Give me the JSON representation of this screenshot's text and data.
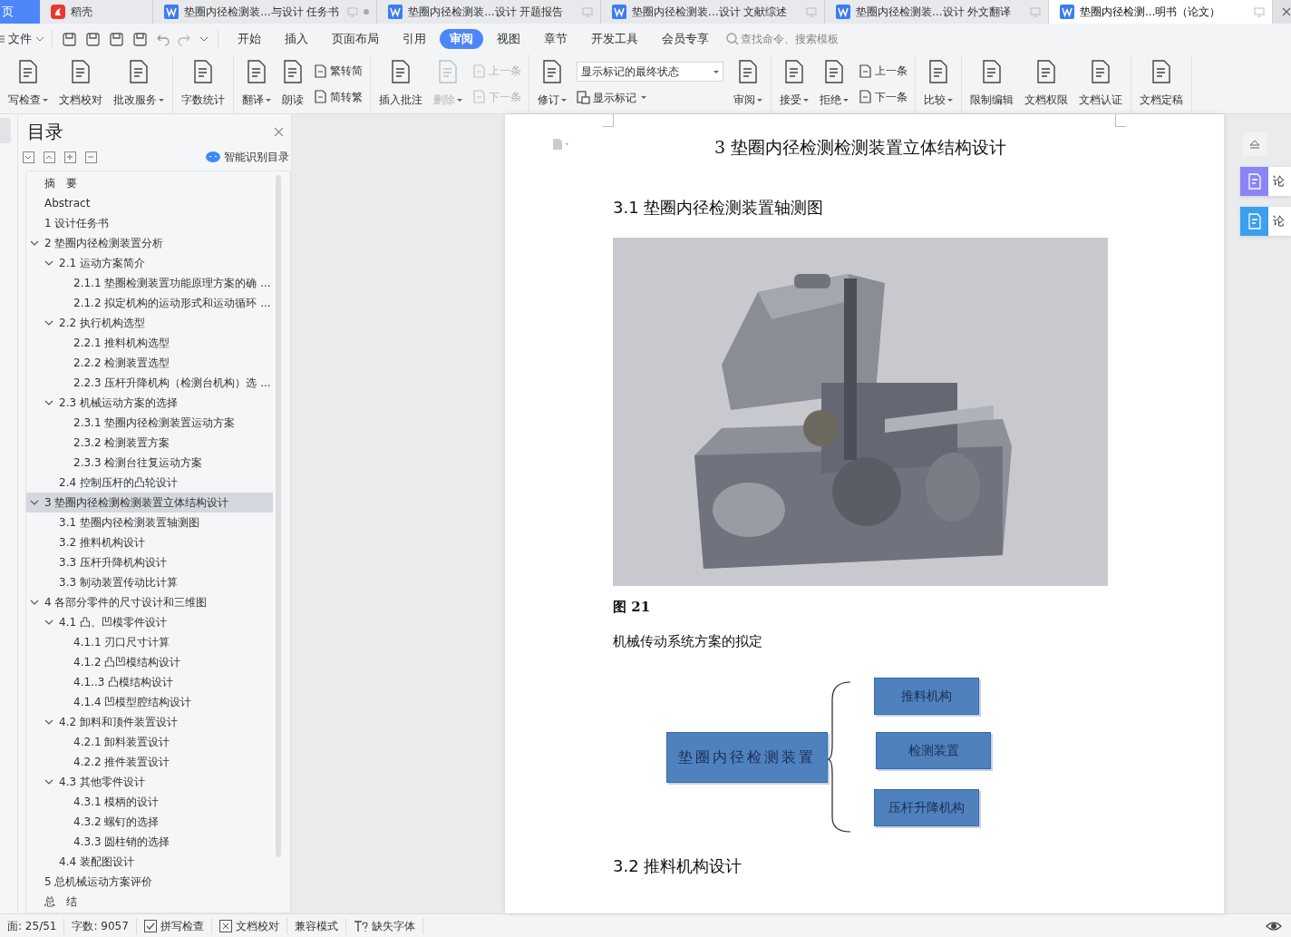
{
  "tab_bar": {
    "tabs": [
      {
        "label": "页",
        "kind": "home",
        "selected": false
      },
      {
        "label": "稻壳",
        "kind": "docer",
        "selected": false
      },
      {
        "label": "垫圈内径检测装...与设计 任务书",
        "kind": "doc",
        "selected": false,
        "unsaved": true
      },
      {
        "label": "垫圈内径检测装...设计 开题报告",
        "kind": "doc",
        "selected": false,
        "unsaved": false
      },
      {
        "label": "垫圈内径检测装...设计 文献综述",
        "kind": "doc",
        "selected": false,
        "unsaved": false
      },
      {
        "label": "垫圈内径检测装...设计 外文翻译",
        "kind": "doc",
        "selected": false,
        "unsaved": false
      },
      {
        "label": "垫圈内径检测...明书（论文）",
        "kind": "doc",
        "selected": true,
        "unsaved": false
      }
    ]
  },
  "menu_bar": {
    "file": "文件",
    "tabs": [
      {
        "label": "开始",
        "selected": false
      },
      {
        "label": "插入",
        "selected": false
      },
      {
        "label": "页面布局",
        "selected": false
      },
      {
        "label": "引用",
        "selected": false
      },
      {
        "label": "审阅",
        "selected": true
      },
      {
        "label": "视图",
        "selected": false
      },
      {
        "label": "章节",
        "selected": false
      },
      {
        "label": "开发工具",
        "selected": false
      },
      {
        "label": "会员专享",
        "selected": false
      }
    ],
    "search": {
      "placeholder": "查找命令、搜索模板"
    }
  },
  "ribbon": {
    "groups": [
      [
        {
          "kind": "big",
          "label": "写检查",
          "dropdown": true,
          "disabled": false
        },
        {
          "kind": "big",
          "label": "文档校对",
          "dropdown": false,
          "disabled": false
        },
        {
          "kind": "big",
          "label": "批改服务",
          "dropdown": true,
          "disabled": false
        }
      ],
      [
        {
          "kind": "big",
          "label": "字数统计",
          "dropdown": false,
          "disabled": false
        }
      ],
      [
        {
          "kind": "big",
          "label": "翻译",
          "dropdown": true,
          "disabled": false
        },
        {
          "kind": "big",
          "label": "朗读",
          "dropdown": false,
          "disabled": false
        },
        {
          "kind": "pair",
          "rows": [
            {
              "label": "繁转简",
              "disabled": false
            },
            {
              "label": "简转繁",
              "disabled": false
            }
          ]
        }
      ],
      [
        {
          "kind": "big",
          "label": "插入批注",
          "dropdown": false,
          "disabled": false
        },
        {
          "kind": "big",
          "label": "删除",
          "dropdown": true,
          "disabled": true
        },
        {
          "kind": "pair",
          "rows": [
            {
              "label": "上一条",
              "disabled": true
            },
            {
              "label": "下一条",
              "disabled": true
            }
          ]
        }
      ],
      [
        {
          "kind": "big",
          "label": "修订",
          "dropdown": true,
          "disabled": false
        },
        {
          "kind": "combo",
          "value": "显示标记的最终状态",
          "button": "显示标记"
        },
        {
          "kind": "big",
          "label": "审阅",
          "dropdown": true,
          "disabled": false
        }
      ],
      [
        {
          "kind": "big",
          "label": "接受",
          "dropdown": true,
          "disabled": false
        },
        {
          "kind": "big",
          "label": "拒绝",
          "dropdown": true,
          "disabled": false
        },
        {
          "kind": "pair",
          "rows": [
            {
              "label": "上一条",
              "disabled": false
            },
            {
              "label": "下一条",
              "disabled": false
            }
          ]
        }
      ],
      [
        {
          "kind": "big",
          "label": "比较",
          "dropdown": true,
          "disabled": false
        }
      ],
      [
        {
          "kind": "big",
          "label": "限制编辑",
          "dropdown": false,
          "disabled": false
        },
        {
          "kind": "big",
          "label": "文档权限",
          "dropdown": false,
          "disabled": false
        },
        {
          "kind": "big",
          "label": "文档认证",
          "dropdown": false,
          "disabled": false
        }
      ],
      [
        {
          "kind": "big",
          "label": "文档定稿",
          "dropdown": false,
          "disabled": false
        }
      ]
    ]
  },
  "toc": {
    "title": "目录",
    "smart_button": "智能识别目录",
    "items": [
      {
        "label": "摘　要",
        "selected": false
      },
      {
        "label": "Abstract",
        "selected": false
      },
      {
        "label": "1 设计任务书",
        "selected": false
      },
      {
        "label": "2 垫圈内径检测装置分析",
        "selected": false,
        "expanded": true,
        "children": [
          {
            "label": "2.1 运动方案简介",
            "selected": false,
            "expanded": true,
            "children": [
              {
                "label": "2.1.1 垫圈检测装置功能原理方案的确 ...",
                "selected": false
              },
              {
                "label": "2.1.2 拟定机构的运动形式和运动循环 ...",
                "selected": false
              }
            ]
          },
          {
            "label": "2.2 执行机构选型",
            "selected": false,
            "expanded": true,
            "children": [
              {
                "label": "2.2.1 推料机构选型",
                "selected": false
              },
              {
                "label": "2.2.2 检测装置选型",
                "selected": false
              },
              {
                "label": "2.2.3 压杆升降机构（检测台机构）选 ...",
                "selected": false
              }
            ]
          },
          {
            "label": "2.3 机械运动方案的选择",
            "selected": false,
            "expanded": true,
            "children": [
              {
                "label": "2.3.1 垫圈内径检测装置运动方案",
                "selected": false
              },
              {
                "label": "2.3.2 检测装置方案",
                "selected": false
              },
              {
                "label": "2.3.3 检测台往复运动方案",
                "selected": false
              }
            ]
          },
          {
            "label": "2.4 控制压杆的凸轮设计",
            "selected": false
          }
        ]
      },
      {
        "label": "3 垫圈内径检测检测装置立体结构设计",
        "selected": true,
        "expanded": true,
        "children": [
          {
            "label": "3.1 垫圈内径检测装置轴测图",
            "selected": false
          },
          {
            "label": "3.2 推料机构设计",
            "selected": false
          },
          {
            "label": "3.3 压杆升降机构设计",
            "selected": false
          },
          {
            "label": "3.3 制动装置传动比计算",
            "selected": false
          }
        ]
      },
      {
        "label": "4 各部分零件的尺寸设计和三维图",
        "selected": false,
        "expanded": true,
        "children": [
          {
            "label": "4.1 凸、凹模零件设计",
            "selected": false,
            "expanded": true,
            "children": [
              {
                "label": "4.1.1 刃口尺寸计算",
                "selected": false
              },
              {
                "label": "4.1.2 凸凹模结构设计",
                "selected": false
              },
              {
                "label": "4.1..3 凸模结构设计",
                "selected": false
              },
              {
                "label": "4.1.4 凹模型腔结构设计",
                "selected": false
              }
            ]
          },
          {
            "label": "4.2 卸料和顶件装置设计",
            "selected": false,
            "expanded": true,
            "children": [
              {
                "label": "4.2.1 卸料装置设计",
                "selected": false
              },
              {
                "label": "4.2.2 推件装置设计",
                "selected": false
              }
            ]
          },
          {
            "label": "4.3 其他零件设计",
            "selected": false,
            "expanded": true,
            "children": [
              {
                "label": "4.3.1 模柄的设计",
                "selected": false
              },
              {
                "label": "4.3.2 螺钉的选择",
                "selected": false
              },
              {
                "label": "4.3.3 圆柱销的选择",
                "selected": false
              }
            ]
          },
          {
            "label": "4.4 装配图设计",
            "selected": false
          }
        ]
      },
      {
        "label": "5 总机械运动方案评价",
        "selected": false
      },
      {
        "label": "总　结",
        "selected": false
      }
    ]
  },
  "document": {
    "chapter_title": "3 垫圈内径检测检测装置立体结构设计",
    "section_title": "3.1 垫圈内径检测装置轴测图",
    "caption": "图 21",
    "paragraph": "机械传动系统方案的拟定",
    "diagram": {
      "root": "垫圈内径检测装置",
      "branches": [
        "推料机构",
        "检测装置",
        "压杆升降机构"
      ]
    },
    "next_section_title": "3.2 推料机构设计"
  },
  "side_panel": {
    "cards": [
      {
        "label": "论"
      },
      {
        "label": "论"
      }
    ]
  },
  "status_bar": {
    "items": [
      {
        "kind": "text",
        "label": "面: 25/51"
      },
      {
        "kind": "text",
        "label": "字数: 9057"
      },
      {
        "kind": "check",
        "label": "拼写检查"
      },
      {
        "kind": "cross",
        "label": "文档校对"
      },
      {
        "kind": "text",
        "label": "兼容模式"
      },
      {
        "kind": "font",
        "label": "缺失字体"
      }
    ]
  }
}
